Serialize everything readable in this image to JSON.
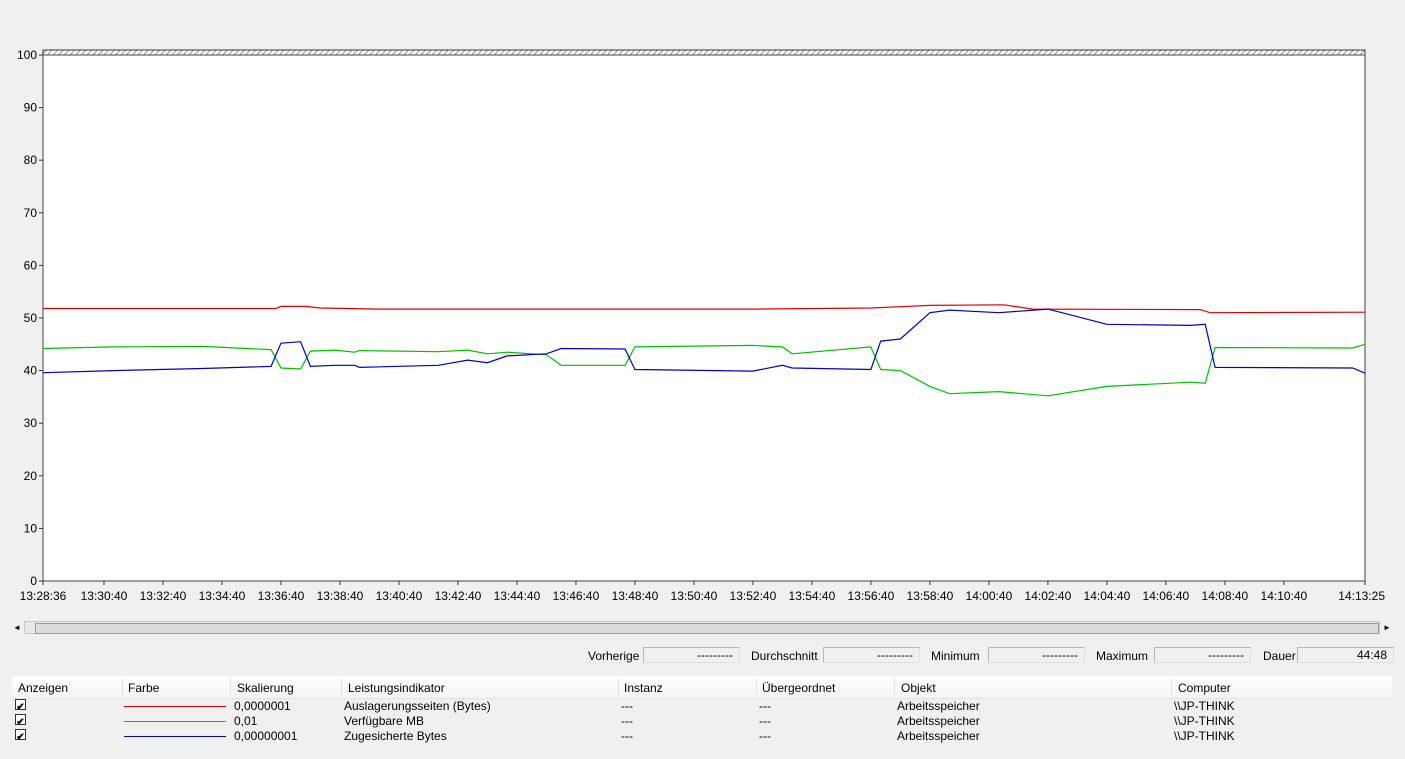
{
  "chart_data": {
    "type": "line",
    "ylim": [
      0,
      100
    ],
    "y_ticks": [
      0,
      10,
      20,
      30,
      40,
      50,
      60,
      70,
      80,
      90,
      100
    ],
    "x_range": [
      "13:28:36",
      "14:13:25"
    ],
    "x_ticks": [
      "13:28:36",
      "13:30:40",
      "13:32:40",
      "13:34:40",
      "13:36:40",
      "13:38:40",
      "13:40:40",
      "13:42:40",
      "13:44:40",
      "13:46:40",
      "13:48:40",
      "13:50:40",
      "13:52:40",
      "13:54:40",
      "13:56:40",
      "13:58:40",
      "14:00:40",
      "14:02:40",
      "14:04:40",
      "14:06:40",
      "14:08:40",
      "14:10:40",
      "14:13:25"
    ],
    "grid": false,
    "series": [
      {
        "name": "Auslagerungsseiten (Bytes)",
        "color": "#e00000",
        "x": [
          "13:28:36",
          "13:36:30",
          "13:36:40",
          "13:37:30",
          "13:38:00",
          "13:40:00",
          "13:52:40",
          "13:56:40",
          "13:58:40",
          "14:01:10",
          "14:02:10",
          "14:07:50",
          "14:08:10",
          "14:13:25"
        ],
        "values": [
          51.8,
          51.8,
          52.2,
          52.2,
          51.9,
          51.7,
          51.7,
          51.9,
          52.4,
          52.5,
          51.7,
          51.6,
          51.0,
          51.1
        ]
      },
      {
        "name": "Verfügbare MB",
        "color": "#00c000",
        "x": [
          "13:28:36",
          "13:31:00",
          "13:34:00",
          "13:36:20",
          "13:36:40",
          "13:37:20",
          "13:37:40",
          "13:38:30",
          "13:39:10",
          "13:39:20",
          "13:42:00",
          "13:43:00",
          "13:43:40",
          "13:44:20",
          "13:45:40",
          "13:46:10",
          "13:48:20",
          "13:48:40",
          "13:52:40",
          "13:53:40",
          "13:54:00",
          "13:56:40",
          "13:57:00",
          "13:57:40",
          "13:58:40",
          "13:59:20",
          "14:01:00",
          "14:02:40",
          "14:04:40",
          "14:07:30",
          "14:08:00",
          "14:08:20",
          "14:13:00",
          "14:13:25"
        ],
        "values": [
          44.2,
          44.5,
          44.6,
          44.0,
          40.5,
          40.3,
          43.7,
          43.9,
          43.5,
          43.8,
          43.6,
          43.9,
          43.2,
          43.5,
          43.0,
          41.0,
          41.0,
          44.5,
          44.8,
          44.5,
          43.2,
          44.5,
          40.2,
          40.0,
          37.0,
          35.6,
          36.0,
          35.2,
          37.0,
          37.8,
          37.6,
          44.4,
          44.3,
          45.0
        ]
      },
      {
        "name": "Zugesicherte Bytes",
        "color": "#0000c0",
        "x": [
          "13:28:36",
          "13:31:00",
          "13:34:00",
          "13:36:20",
          "13:36:40",
          "13:37:20",
          "13:37:40",
          "13:38:30",
          "13:39:10",
          "13:39:20",
          "13:42:00",
          "13:43:00",
          "13:43:40",
          "13:44:20",
          "13:45:40",
          "13:46:10",
          "13:48:20",
          "13:48:40",
          "13:52:40",
          "13:53:40",
          "13:54:00",
          "13:56:40",
          "13:57:00",
          "13:57:40",
          "13:58:40",
          "13:59:20",
          "14:01:00",
          "14:02:40",
          "14:04:40",
          "14:07:30",
          "14:08:00",
          "14:08:20",
          "14:13:00",
          "14:13:25"
        ],
        "values": [
          39.6,
          40.0,
          40.4,
          40.8,
          45.2,
          45.5,
          40.8,
          41.0,
          41.0,
          40.6,
          41.0,
          42.0,
          41.5,
          42.8,
          43.2,
          44.2,
          44.1,
          40.2,
          39.9,
          41.0,
          40.5,
          40.2,
          45.6,
          46.0,
          51.0,
          51.5,
          51.0,
          51.7,
          48.8,
          48.6,
          48.8,
          40.6,
          40.5,
          39.5
        ]
      }
    ]
  },
  "scrollbar": {
    "left_arrow": "◄",
    "right_arrow": "►"
  },
  "stats": {
    "previous_label": "Vorherige",
    "previous_value": "---------",
    "average_label": "Durchschnitt",
    "average_value": "---------",
    "minimum_label": "Minimum",
    "minimum_value": "---------",
    "maximum_label": "Maximum",
    "maximum_value": "---------",
    "duration_label": "Dauer",
    "duration_value": "44:48"
  },
  "legend": {
    "columns": [
      "Anzeigen",
      "Farbe",
      "Skalierung",
      "Leistungsindikator",
      "Instanz",
      "Übergeordnet",
      "Objekt",
      "Computer"
    ],
    "rows": [
      {
        "checked": "✔",
        "color": "#e00000",
        "scale": "0,0000001",
        "counter": "Auslagerungsseiten (Bytes)",
        "instance": "---",
        "parent": "---",
        "object": "Arbeitsspeicher",
        "computer": "\\\\JP-THINK"
      },
      {
        "checked": "✔",
        "color": "#00c000",
        "scale": "0,01",
        "counter": "Verfügbare MB",
        "instance": "---",
        "parent": "---",
        "object": "Arbeitsspeicher",
        "computer": "\\\\JP-THINK"
      },
      {
        "checked": "✔",
        "color": "#0000c0",
        "scale": "0,00000001",
        "counter": "Zugesicherte Bytes",
        "instance": "---",
        "parent": "---",
        "object": "Arbeitsspeicher",
        "computer": "\\\\JP-THINK"
      }
    ]
  }
}
